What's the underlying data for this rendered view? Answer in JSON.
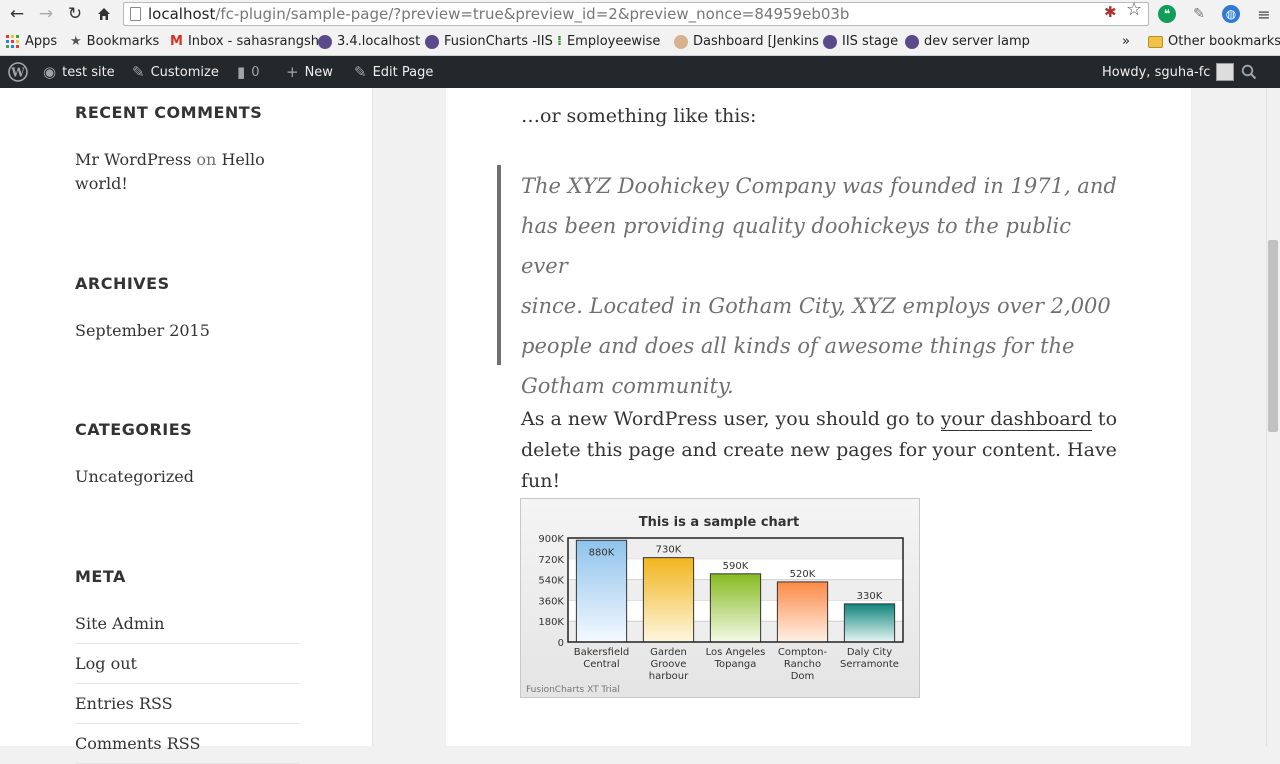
{
  "browser": {
    "url_host": "localhost",
    "url_path": "/fc-plugin/sample-page/?preview=true&preview_id=2&preview_nonce=84959eb03b",
    "bookmarks": [
      {
        "label": "Apps"
      },
      {
        "label": "Bookmarks"
      },
      {
        "label": "Inbox - sahasrangsh"
      },
      {
        "label": "3.4.localhost"
      },
      {
        "label": "FusionCharts -IIS"
      },
      {
        "label": "Employeewise"
      },
      {
        "label": "Dashboard [Jenkins"
      },
      {
        "label": "IIS stage"
      },
      {
        "label": "dev server lamp"
      }
    ],
    "overflow": "»",
    "other_bookmarks": "Other bookmarks"
  },
  "adminbar": {
    "site_name": "test site",
    "customize": "Customize",
    "comments_count": "0",
    "new_label": "New",
    "edit_page": "Edit Page",
    "howdy": "Howdy, sguha-fc"
  },
  "sidebar": {
    "recent_comments": {
      "title": "RECENT COMMENTS",
      "author": "Mr WordPress",
      "on": "on",
      "post_line1": "Hello",
      "post_line2": "world!"
    },
    "archives": {
      "title": "ARCHIVES",
      "item": "September 2015"
    },
    "categories": {
      "title": "CATEGORIES",
      "item": "Uncategorized"
    },
    "meta": {
      "title": "META",
      "items": [
        "Site Admin",
        "Log out",
        "Entries RSS",
        "Comments RSS"
      ]
    }
  },
  "content": {
    "lead": "…or something like this:",
    "quote_lines": [
      "The XYZ Doohickey Company was founded in 1971, and",
      "has been providing quality doohickeys to the public ever",
      "since. Located in Gotham City, XYZ employs over 2,000",
      "people and does all kinds of awesome things for the",
      "Gotham community."
    ],
    "para_before": "As a new WordPress user, you should go to ",
    "para_link": "your dashboard",
    "para_after_line1": " to",
    "para_line2": "delete this page and create new pages for your content. Have fun!"
  },
  "chart_data": {
    "type": "bar",
    "title": "This is a sample chart",
    "categories": [
      [
        "Bakersfield",
        "Central"
      ],
      [
        "Garden",
        "Groove",
        "harbour"
      ],
      [
        "Los Angeles",
        "Topanga"
      ],
      [
        "Compton-",
        "Rancho",
        "Dom"
      ],
      [
        "Daly City",
        "Serramonte"
      ]
    ],
    "values": [
      880000,
      730000,
      590000,
      520000,
      330000
    ],
    "value_labels": [
      "880K",
      "730K",
      "590K",
      "520K",
      "330K"
    ],
    "ylim": [
      0,
      900000
    ],
    "yticks": [
      0,
      180000,
      360000,
      540000,
      720000,
      900000
    ],
    "ytick_labels": [
      "0",
      "180K",
      "360K",
      "540K",
      "720K",
      "900K"
    ],
    "grid": true,
    "colors": [
      [
        "#8fc3ec",
        "#f4f9ff"
      ],
      [
        "#f1b51d",
        "#fdf6df"
      ],
      [
        "#86bb21",
        "#f3f9e6"
      ],
      [
        "#fb8a46",
        "#fff1e8"
      ],
      [
        "#10857c",
        "#e6f5f4"
      ]
    ],
    "watermark": "FusionCharts XT Trial"
  }
}
